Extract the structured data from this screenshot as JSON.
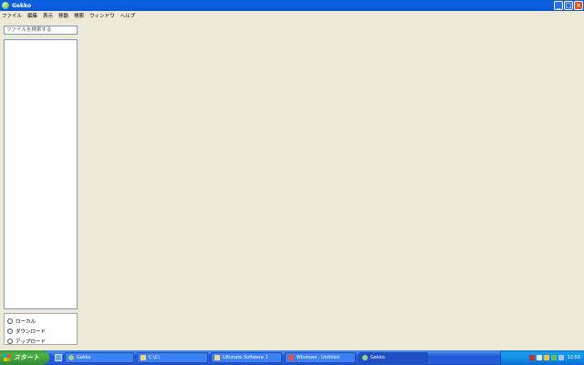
{
  "window": {
    "title": "Gekko"
  },
  "menu": [
    "ファイル",
    "編集",
    "表示",
    "移動",
    "検索",
    "ウィンドウ",
    "ヘルプ"
  ],
  "search": {
    "placeholder": "ファイルを検索する"
  },
  "radios": [
    "ローカル",
    "ダウンロード",
    "アップロード"
  ],
  "taskbar": {
    "start_label": "スタート",
    "tasks": [
      "Gekko",
      "C:\\Cl",
      "Ultimate Software 1",
      "Windows · Untitled",
      "Gekko"
    ],
    "clock": "12:59"
  },
  "colors": {
    "titlebar": "#0b61e4",
    "taskbar": "#245edb",
    "start": "#3c9a3c",
    "workspace": "#ece9d8"
  }
}
